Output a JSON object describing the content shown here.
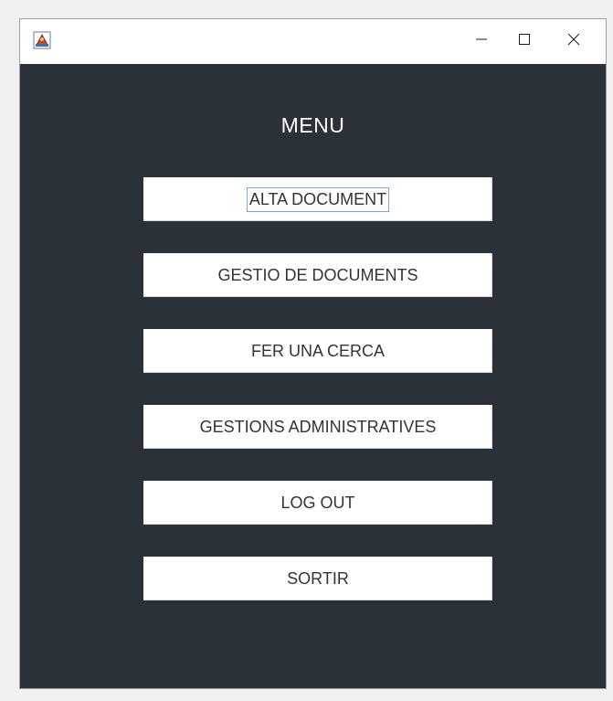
{
  "window": {
    "controls": {
      "minimize_icon": "minimize-icon",
      "maximize_icon": "maximize-icon",
      "close_icon": "close-icon"
    },
    "background_color": "#2b3138"
  },
  "menu": {
    "title": "MENU",
    "buttons": [
      {
        "label": "ALTA DOCUMENT",
        "focused": true
      },
      {
        "label": "GESTIO DE DOCUMENTS",
        "focused": false
      },
      {
        "label": "FER UNA CERCA",
        "focused": false
      },
      {
        "label": "GESTIONS ADMINISTRATIVES",
        "focused": false
      },
      {
        "label": "LOG OUT",
        "focused": false
      },
      {
        "label": "SORTIR",
        "focused": false
      }
    ]
  }
}
